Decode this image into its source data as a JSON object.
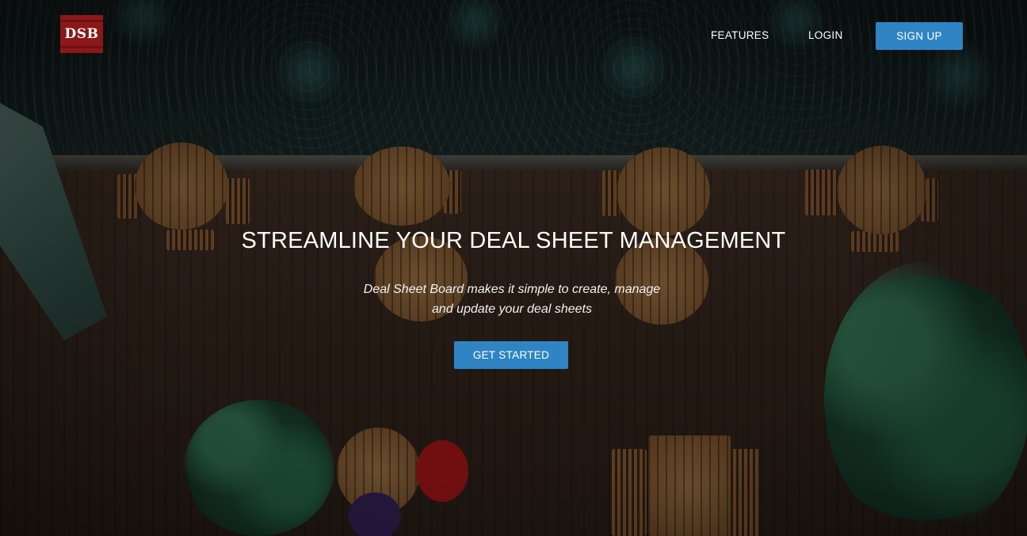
{
  "brand": {
    "logo_text": "DSB",
    "logo_color": "#8b1818"
  },
  "nav": {
    "features_label": "FEATURES",
    "login_label": "LOGIN",
    "signup_label": "SIGN UP"
  },
  "hero": {
    "title": "STREAMLINE YOUR DEAL SHEET MANAGEMENT",
    "subtitle_line1": "Deal Sheet Board makes it simple to create, manage",
    "subtitle_line2": "and update your deal sheets",
    "cta_label": "GET STARTED"
  },
  "colors": {
    "accent": "#2f84c4",
    "text": "#ffffff"
  },
  "background": {
    "description_icon": "cafe-deck-aerial-photo"
  }
}
